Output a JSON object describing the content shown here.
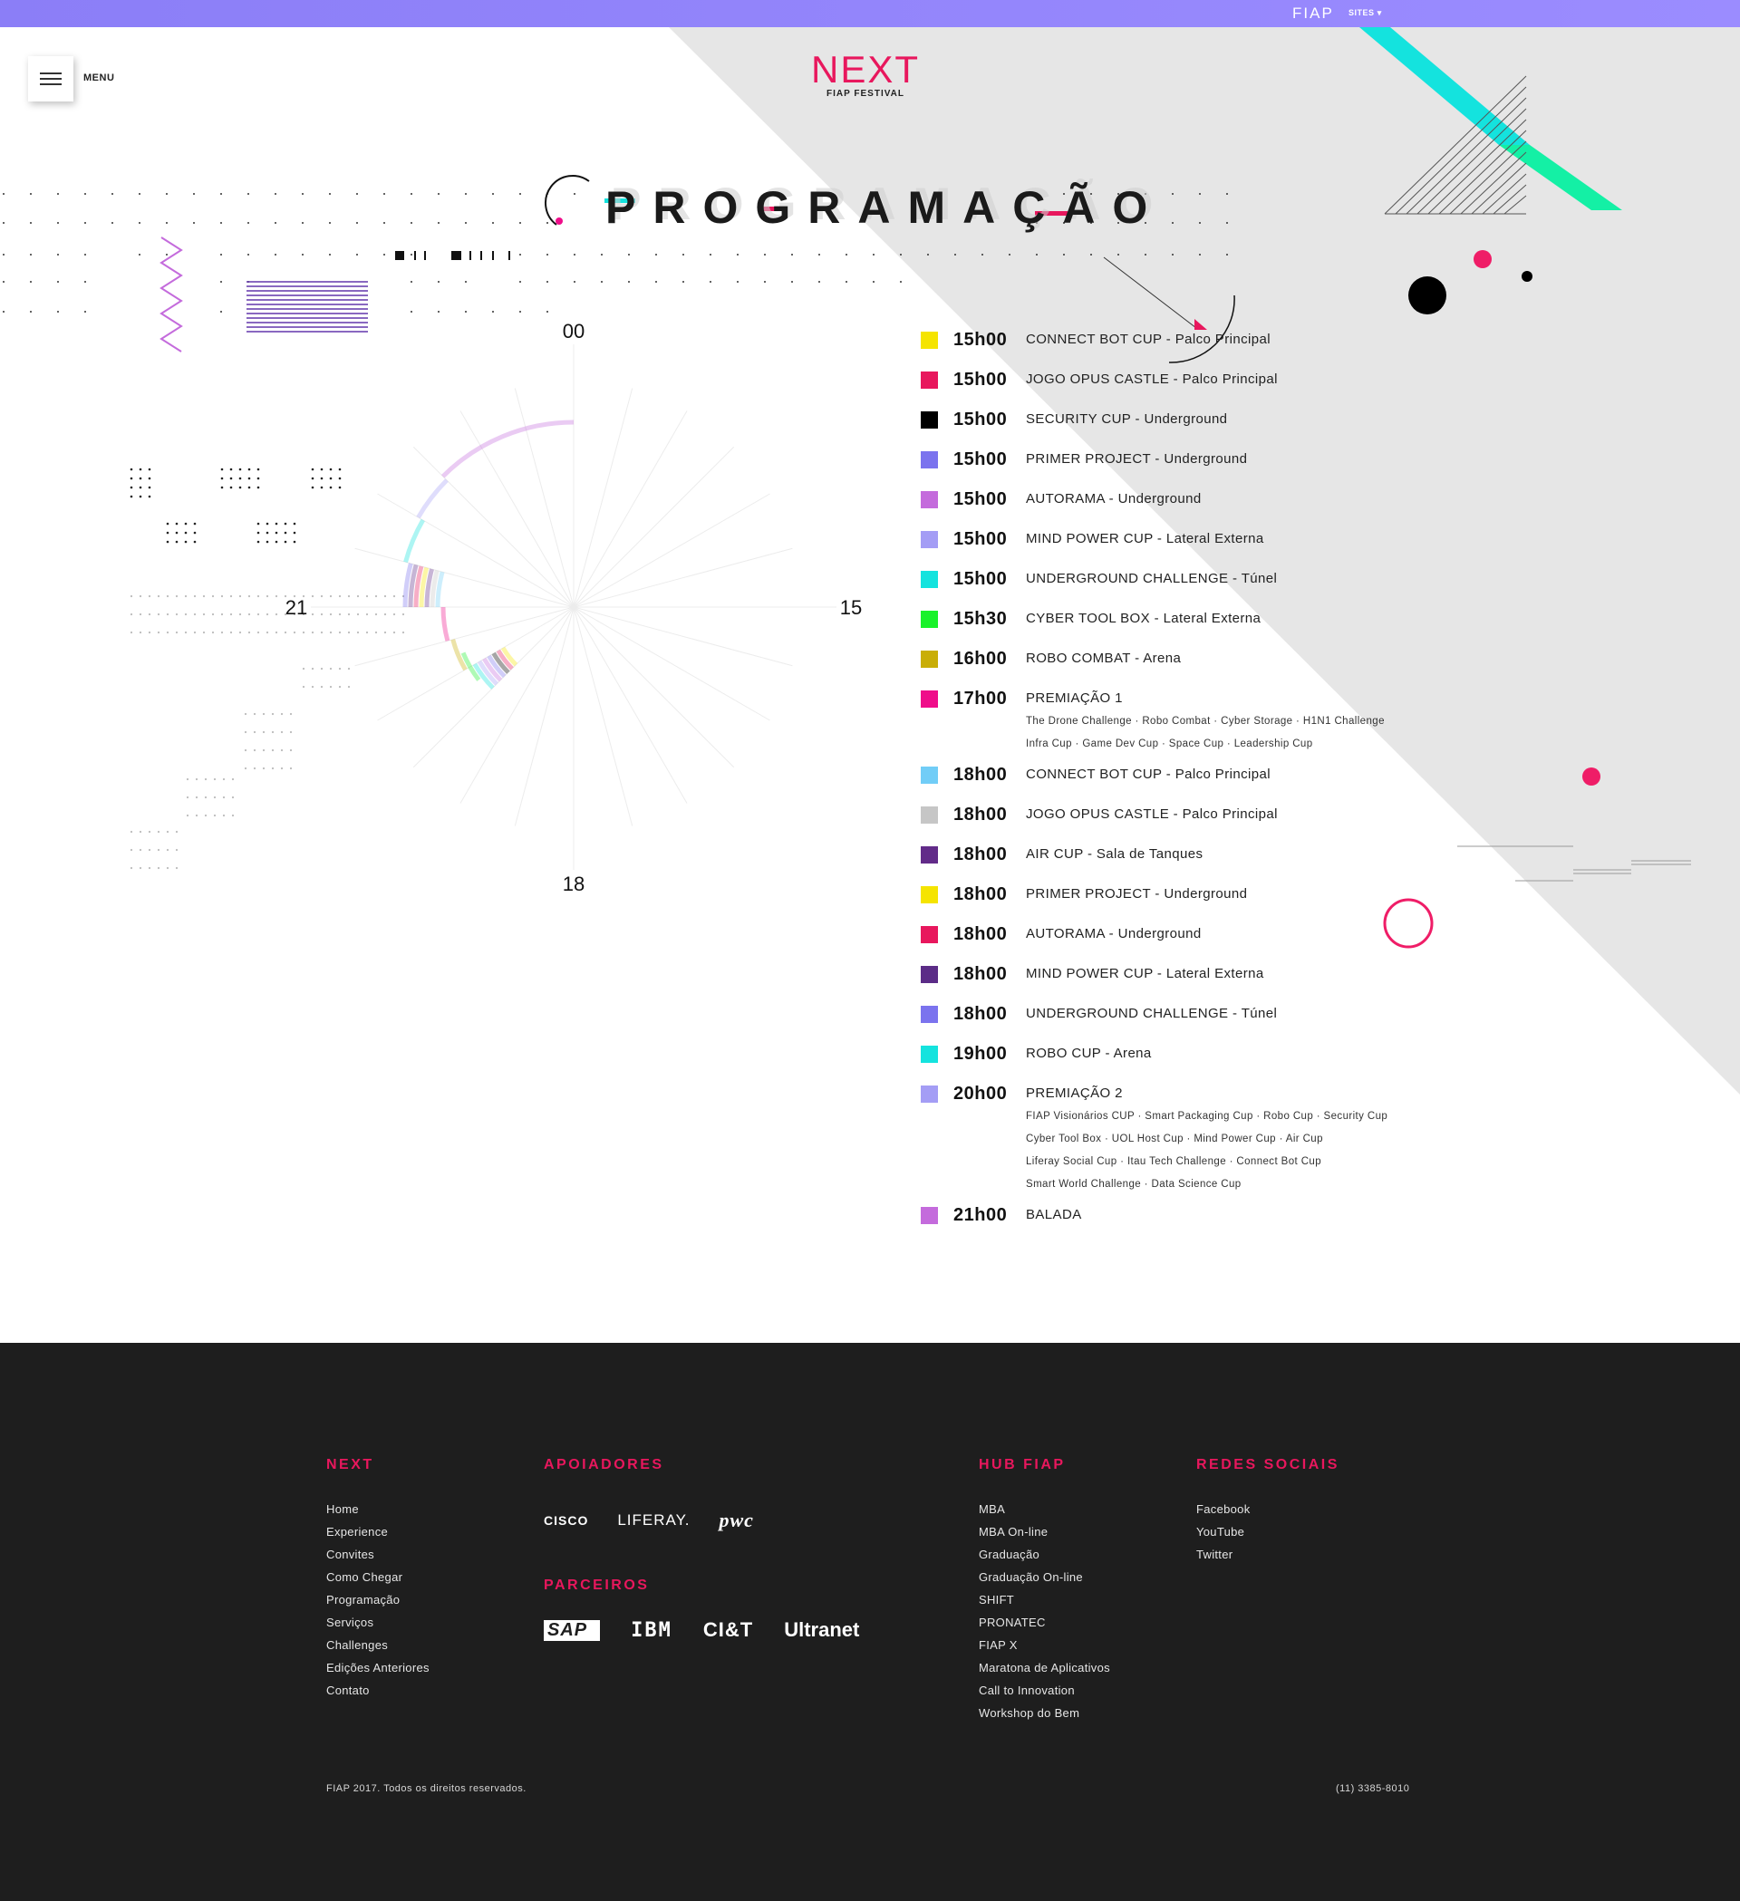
{
  "topbar": {
    "fiap_logo": "FIAP",
    "sites_label": "SITES",
    "sites_chevron": "▾"
  },
  "header": {
    "menu_label": "MENU",
    "logo_text": "NEXT",
    "logo_sub": "FIAP FESTIVAL"
  },
  "page": {
    "title": "PROGRAMAÇÃO"
  },
  "clock": {
    "labels": {
      "top": "00",
      "right": "15",
      "bottom": "18",
      "left": "21"
    }
  },
  "schedule": [
    {
      "time": "15h00",
      "label": "CONNECT BOT CUP - Palco Principal",
      "color": "#f5e400",
      "sub": []
    },
    {
      "time": "15h00",
      "label": "JOGO OPUS CASTLE - Palco Principal",
      "color": "#e8175d",
      "sub": []
    },
    {
      "time": "15h00",
      "label": "SECURITY CUP - Underground",
      "color": "#000000",
      "sub": []
    },
    {
      "time": "15h00",
      "label": "PRIMER PROJECT - Underground",
      "color": "#7b73ee",
      "sub": []
    },
    {
      "time": "15h00",
      "label": "AUTORAMA - Underground",
      "color": "#c46bdc",
      "sub": []
    },
    {
      "time": "15h00",
      "label": "MIND POWER CUP - Lateral Externa",
      "color": "#a49df5",
      "sub": []
    },
    {
      "time": "15h00",
      "label": "UNDERGROUND CHALLENGE - Túnel",
      "color": "#14e3de",
      "sub": []
    },
    {
      "time": "15h30",
      "label": "CYBER TOOL BOX - Lateral Externa",
      "color": "#19f22a",
      "sub": []
    },
    {
      "time": "16h00",
      "label": "ROBO COMBAT - Arena",
      "color": "#c9ae07",
      "sub": []
    },
    {
      "time": "17h00",
      "label": "PREMIAÇÃO 1",
      "color": "#ef0d8a",
      "sub": [
        "The Drone Challenge · Robo Combat · Cyber Storage · H1N1 Challenge",
        "Infra Cup · Game Dev Cup · Space Cup · Leadership Cup"
      ]
    },
    {
      "time": "18h00",
      "label": "CONNECT BOT CUP - Palco Principal",
      "color": "#71cdf7",
      "sub": []
    },
    {
      "time": "18h00",
      "label": "JOGO OPUS CASTLE - Palco Principal",
      "color": "#c6c6c6",
      "sub": []
    },
    {
      "time": "18h00",
      "label": "AIR CUP - Sala de Tanques",
      "color": "#622b89",
      "sub": []
    },
    {
      "time": "18h00",
      "label": "PRIMER PROJECT - Underground",
      "color": "#f5e400",
      "sub": []
    },
    {
      "time": "18h00",
      "label": "AUTORAMA - Underground",
      "color": "#e8175d",
      "sub": []
    },
    {
      "time": "18h00",
      "label": "MIND POWER CUP - Lateral Externa",
      "color": "#5b2c87",
      "sub": []
    },
    {
      "time": "18h00",
      "label": "UNDERGROUND CHALLENGE - Túnel",
      "color": "#7b73ee",
      "sub": []
    },
    {
      "time": "19h00",
      "label": "ROBO CUP - Arena",
      "color": "#14e3de",
      "sub": []
    },
    {
      "time": "20h00",
      "label": "PREMIAÇÃO 2",
      "color": "#a49df5",
      "sub": [
        "FIAP Visionários CUP · Smart Packaging Cup · Robo Cup · Security Cup",
        "Cyber Tool Box · UOL Host Cup · Mind Power Cup · Air Cup",
        "Liferay Social Cup · Itau Tech Challenge · Connect Bot Cup",
        "Smart World Challenge · Data Science Cup"
      ]
    },
    {
      "time": "21h00",
      "label": "BALADA",
      "color": "#c46bdc",
      "sub": []
    }
  ],
  "footer": {
    "next": {
      "heading": "NEXT",
      "links": [
        "Home",
        "Experience",
        "Convites",
        "Como Chegar",
        "Programação",
        "Serviços",
        "Challenges",
        "Edições Anteriores",
        "Contato"
      ]
    },
    "apoiadores": {
      "heading": "APOIADORES",
      "brands": [
        "CISCO",
        "LIFERAY.",
        "pwc"
      ]
    },
    "parceiros": {
      "heading": "PARCEIROS",
      "brands": [
        "SAP",
        "IBM",
        "CI&T",
        "Ultranet"
      ]
    },
    "hub": {
      "heading": "HUB FIAP",
      "links": [
        "MBA",
        "MBA On-line",
        "Graduação",
        "Graduação On-line",
        "SHIFT",
        "PRONATEC",
        "FIAP X",
        "Maratona de Aplicativos",
        "Call to Innovation",
        "Workshop do Bem"
      ]
    },
    "redes": {
      "heading": "REDES SOCIAIS",
      "links": [
        "Facebook",
        "YouTube",
        "Twitter"
      ]
    },
    "copyright": "FIAP 2017. Todos os direitos reservados.",
    "phone": "(11) 3385-8010"
  }
}
